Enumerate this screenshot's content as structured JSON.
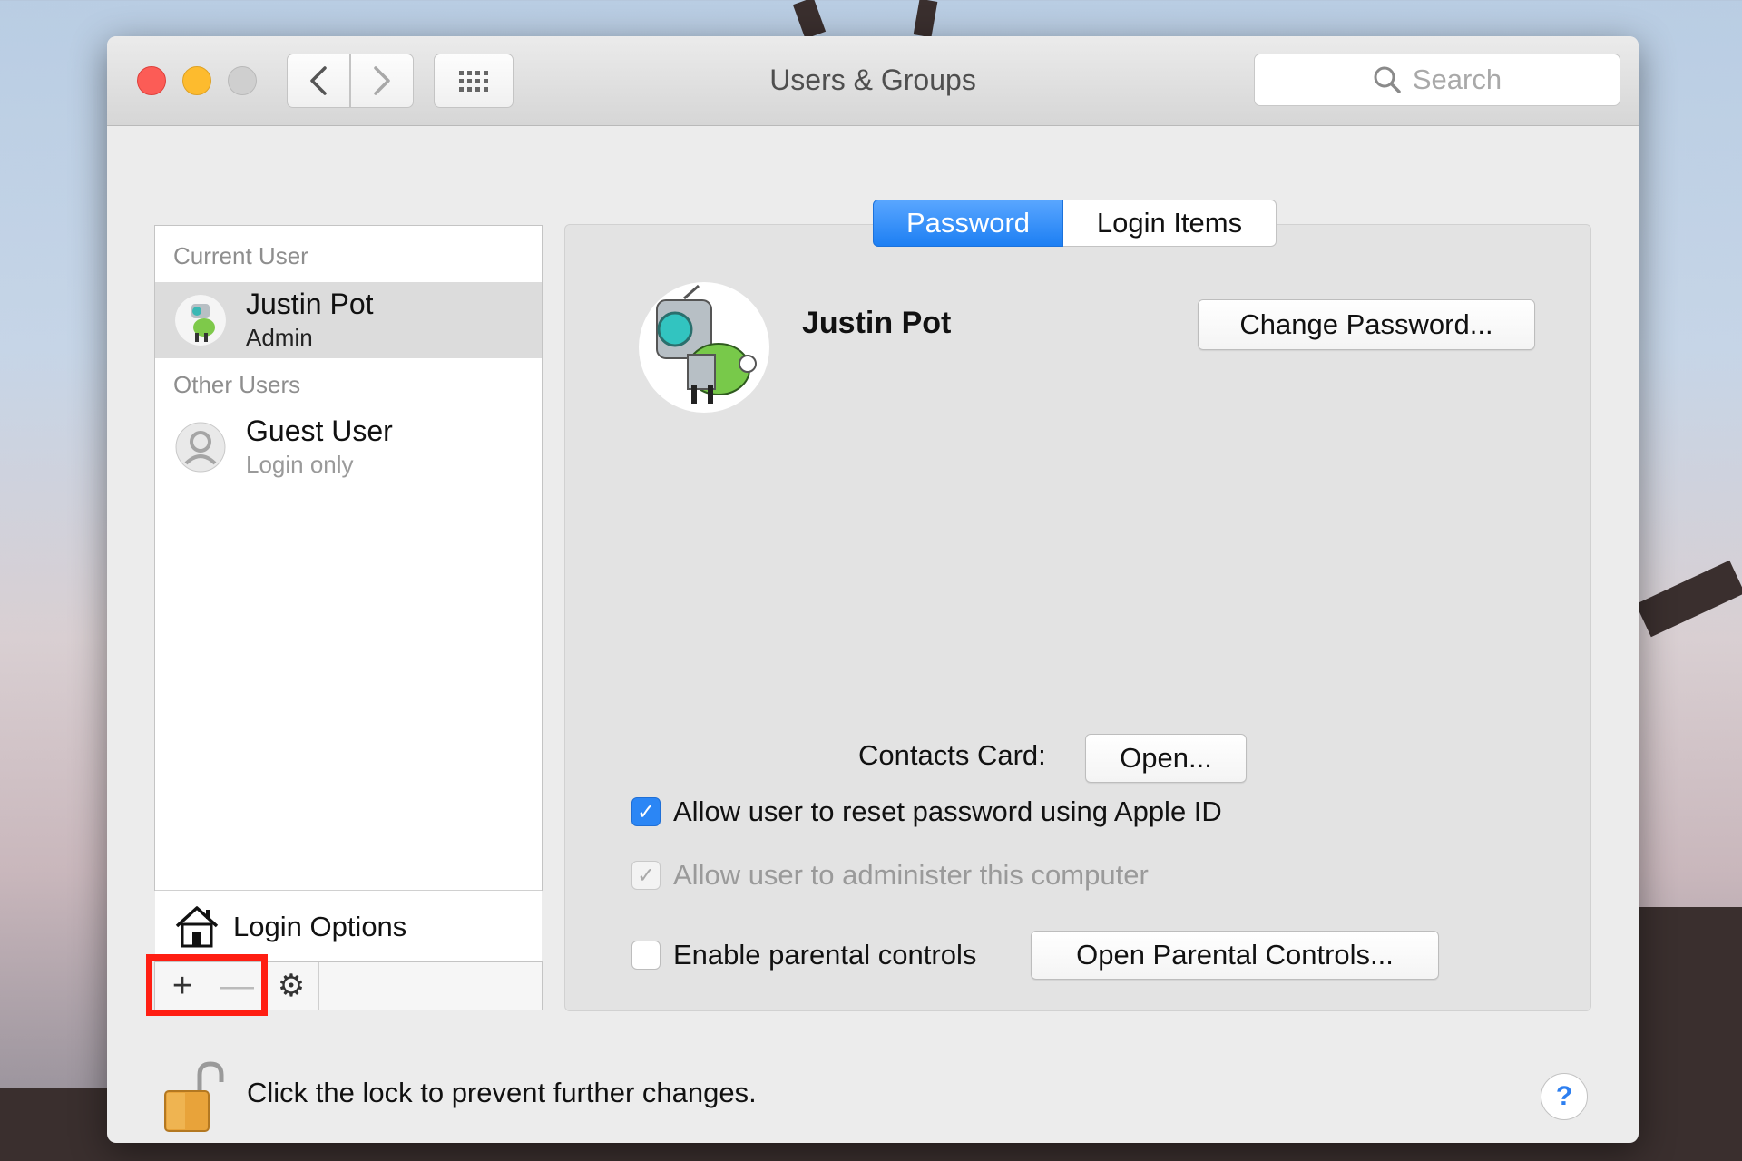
{
  "window": {
    "title": "Users & Groups",
    "search_placeholder": "Search"
  },
  "sidebar": {
    "current_user_label": "Current User",
    "other_users_label": "Other Users",
    "users": [
      {
        "name": "Justin Pot",
        "role": "Admin"
      },
      {
        "name": "Guest User",
        "role": "Login only"
      }
    ],
    "login_options_label": "Login Options",
    "toolbar": {
      "add": "+",
      "remove": "—",
      "gear": "⚙"
    }
  },
  "tabs": [
    {
      "label": "Password",
      "active": true
    },
    {
      "label": "Login Items",
      "active": false
    }
  ],
  "panel": {
    "user_name": "Justin Pot",
    "change_password_button": "Change Password...",
    "contacts_card_label": "Contacts Card:",
    "open_button": "Open...",
    "checkboxes": [
      {
        "label": "Allow user to reset password using Apple ID",
        "state": "checked"
      },
      {
        "label": "Allow user to administer this computer",
        "state": "checked-disabled"
      },
      {
        "label": "Enable parental controls",
        "state": "unchecked"
      }
    ],
    "open_parental_button": "Open Parental Controls..."
  },
  "footer": {
    "lock_text": "Click the lock to prevent further changes.",
    "help": "?"
  },
  "colors": {
    "accent": "#1d7ff3",
    "highlight": "#ff1e12"
  }
}
